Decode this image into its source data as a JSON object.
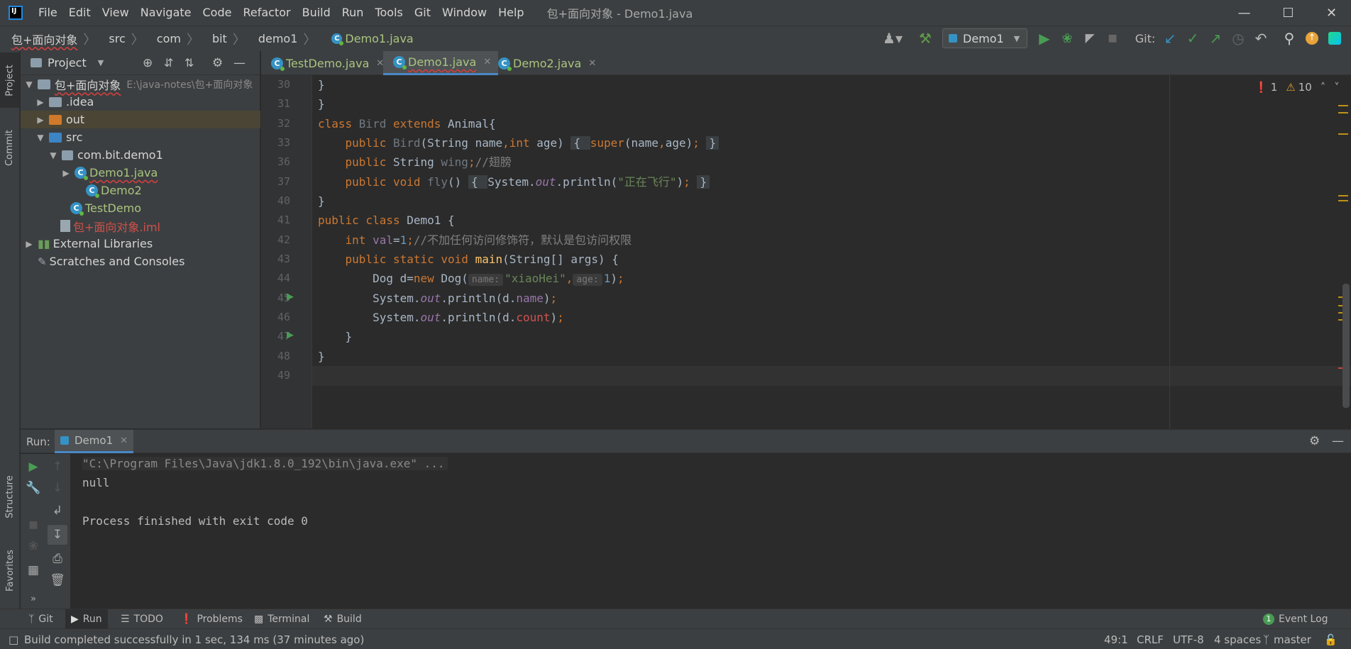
{
  "menu": [
    "File",
    "Edit",
    "View",
    "Navigate",
    "Code",
    "Refactor",
    "Build",
    "Run",
    "Tools",
    "Git",
    "Window",
    "Help"
  ],
  "window_title": "包+面向对象 - Demo1.java",
  "breadcrumb": [
    "包+面向对象",
    "src",
    "com",
    "bit",
    "demo1",
    "Demo1.java"
  ],
  "toolbar": {
    "run_config": "Demo1",
    "git_label": "Git:"
  },
  "left_strip": {
    "project": "Project",
    "commit": "Commit",
    "structure": "Structure",
    "favorites": "Favorites"
  },
  "project_panel": {
    "title": "Project",
    "tree": [
      {
        "label": "包+面向对象",
        "extra": "E:\\java-notes\\包+面向对象"
      },
      {
        "label": ".idea"
      },
      {
        "label": "out"
      },
      {
        "label": "src"
      },
      {
        "label": "com.bit.demo1"
      },
      {
        "label": "Demo1.java"
      },
      {
        "label": "Demo2"
      },
      {
        "label": "TestDemo"
      },
      {
        "label": "包+面向对象.iml"
      },
      {
        "label": "External Libraries"
      },
      {
        "label": "Scratches and Consoles"
      }
    ]
  },
  "editor_tabs": [
    "TestDemo.java",
    "Demo1.java",
    "Demo2.java"
  ],
  "problems": {
    "errors": "1",
    "warnings": "10"
  },
  "line_numbers": [
    "30",
    "31",
    "32",
    "33",
    "36",
    "37",
    "40",
    "41",
    "42",
    "43",
    "44",
    "45",
    "46",
    "47",
    "48",
    "49"
  ],
  "code": {
    "l30": "}",
    "l31": "}",
    "l32_a": "class ",
    "l32_b": "Bird ",
    "l32_c": "extends ",
    "l32_d": "Animal{",
    "l33_a": "    public ",
    "l33_b": "Bird",
    "l33_c": "(String name",
    "l33_d": ",",
    "l33_e": "int ",
    "l33_f": "age) ",
    "l33_g": "{ ",
    "l33_h": "super",
    "l33_i": "(name",
    "l33_j": ",",
    "l33_k": "age)",
    "l33_l": "; ",
    "l33_m": "}",
    "l36_a": "    public ",
    "l36_b": "String ",
    "l36_c": "wing",
    "l36_d": ";",
    "l36_e": "//翅膀",
    "l37_a": "    public void ",
    "l37_b": "fly",
    "l37_c": "() ",
    "l37_d": "{ ",
    "l37_e": "System.",
    "l37_f": "out",
    "l37_g": ".println(",
    "l37_h": "\"正在飞行\"",
    "l37_i": ")",
    "l37_j": "; ",
    "l37_k": "}",
    "l40": "}",
    "l41_a": "public class ",
    "l41_b": "Demo1 {",
    "l42_a": "    int ",
    "l42_b": "val",
    "l42_c": "=",
    "l42_d": "1",
    "l42_e": ";",
    "l42_f": "//不加任何访问修饰符，默认是包访问权限",
    "l43_a": "    public static void ",
    "l43_b": "main",
    "l43_c": "(String[] args) {",
    "l44_a": "        Dog d=",
    "l44_b": "new ",
    "l44_c": "Dog(",
    "l44_hint1": "name:",
    "l44_d": "\"xiaoHei\"",
    "l44_e": ",",
    "l44_hint2": "age:",
    "l44_f": "1",
    "l44_g": ")",
    "l44_h": ";",
    "l45_a": "        System.",
    "l45_b": "out",
    "l45_c": ".println(d.",
    "l45_d": "name",
    "l45_e": ")",
    "l45_f": ";",
    "l46_a": "        System.",
    "l46_b": "out",
    "l46_c": ".println(d.",
    "l46_d": "count",
    "l46_e": ")",
    "l46_f": ";",
    "l47": "    }",
    "l48": "}"
  },
  "run_panel": {
    "label": "Run:",
    "tab": "Demo1",
    "console": [
      "\"C:\\Program Files\\Java\\jdk1.8.0_192\\bin\\java.exe\" ...",
      "null",
      "",
      "Process finished with exit code 0"
    ]
  },
  "bottom_tools": [
    "Git",
    "Run",
    "TODO",
    "Problems",
    "Terminal",
    "Build"
  ],
  "event_log": "Event Log",
  "status": {
    "message": "Build completed successfully in 1 sec, 134 ms (37 minutes ago)",
    "position": "49:1",
    "line_sep": "CRLF",
    "encoding": "UTF-8",
    "indent": "4 spaces",
    "branch": "master"
  }
}
